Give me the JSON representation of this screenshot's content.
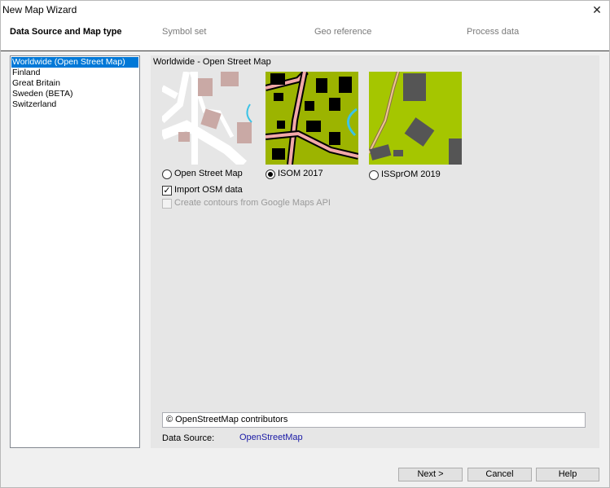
{
  "window": {
    "title": "New Map Wizard",
    "close_glyph": "✕"
  },
  "steps": [
    {
      "label": "Data Source and Map type",
      "active": true
    },
    {
      "label": "Symbol set",
      "active": false
    },
    {
      "label": "Geo reference",
      "active": false
    },
    {
      "label": "Process data",
      "active": false
    }
  ],
  "regions": {
    "items": [
      "Worldwide (Open Street Map)",
      "Finland",
      "Great Britain",
      "Sweden (BETA)",
      "Switzerland"
    ],
    "selected": "Worldwide (Open Street Map)"
  },
  "panel": {
    "title": "Worldwide - Open Street Map",
    "map_types": [
      {
        "label": "Open Street Map",
        "checked": false
      },
      {
        "label": "ISOM 2017",
        "checked": true
      },
      {
        "label": "ISSprOM 2019",
        "checked": false
      }
    ],
    "options": {
      "import_osm": {
        "label": "Import OSM data",
        "checked": true,
        "enabled": true
      },
      "contours": {
        "label": "Create contours from Google Maps API",
        "checked": false,
        "enabled": false
      }
    },
    "attribution": "© OpenStreetMap contributors",
    "data_source_label": "Data Source:",
    "data_source_value": "OpenStreetMap"
  },
  "buttons": {
    "next": "Next  >",
    "cancel": "Cancel",
    "help": "Help"
  },
  "colors": {
    "selection": "#0078d7",
    "link": "#1a1aa6",
    "osm_background": "#e6e6e6",
    "osm_building": "#c9a9a5",
    "isom_vegetation": "#9cb400",
    "isom_road": "#f2a8a8",
    "water": "#3cc3e6",
    "issprom_vegetation": "#a5c600",
    "issprom_building": "#555555",
    "issprom_path": "#f0c890"
  }
}
